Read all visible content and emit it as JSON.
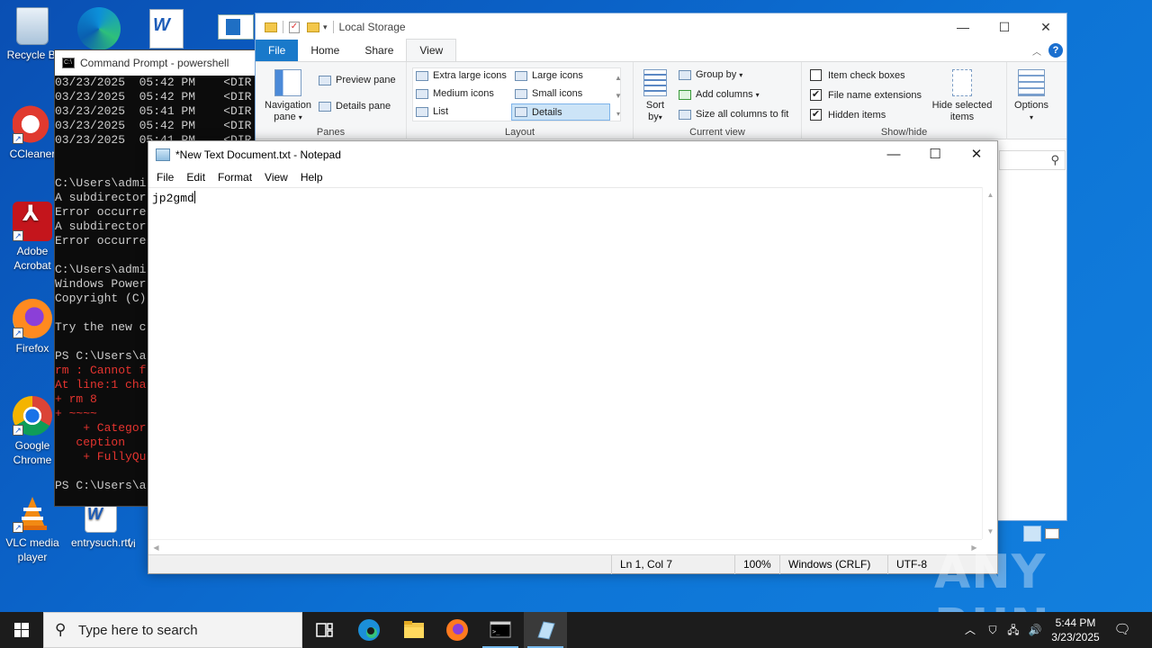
{
  "desktop": {
    "icons": [
      {
        "label": "Recycle Bin"
      },
      {
        "label": "CCleaner"
      },
      {
        "label": "Adobe Acrobat"
      },
      {
        "label": "Firefox"
      },
      {
        "label": "Google Chrome"
      },
      {
        "label": "VLC media player"
      },
      {
        "label": "entrysuch.rtf"
      }
    ],
    "recycle_label": "Recycle Bi",
    "ccleaner_label": "CCleaner",
    "acrobat_label_1": "Adobe",
    "acrobat_label_2": "Acrobat",
    "firefox_label": "Firefox",
    "chrome_label_1": "Google",
    "chrome_label_2": "Chrome",
    "vlc_label_1": "VLC media",
    "vlc_label_2": "player",
    "rtf_label": "entrysuch.rtf",
    "partial_label": "vi"
  },
  "cmd": {
    "title": "Command Prompt - powershell",
    "lines": [
      {
        "text": "03/23/2025  05:42 PM    <DIR",
        "color": "normal"
      },
      {
        "text": "03/23/2025  05:42 PM    <DIR",
        "color": "normal"
      },
      {
        "text": "03/23/2025  05:41 PM    <DIR",
        "color": "normal"
      },
      {
        "text": "03/23/2025  05:42 PM    <DIR",
        "color": "normal"
      },
      {
        "text": "03/23/2025  05:41 PM    <DIR",
        "color": "normal"
      },
      {
        "text": "",
        "color": "normal"
      },
      {
        "text": "",
        "color": "normal"
      },
      {
        "text": "C:\\Users\\admi",
        "color": "normal"
      },
      {
        "text": "A subdirector",
        "color": "normal"
      },
      {
        "text": "Error occurre",
        "color": "normal"
      },
      {
        "text": "A subdirector",
        "color": "normal"
      },
      {
        "text": "Error occurre",
        "color": "normal"
      },
      {
        "text": "",
        "color": "normal"
      },
      {
        "text": "C:\\Users\\admi",
        "color": "normal"
      },
      {
        "text": "Windows Power",
        "color": "normal"
      },
      {
        "text": "Copyright (C)",
        "color": "normal"
      },
      {
        "text": "",
        "color": "normal"
      },
      {
        "text": "Try the new c",
        "color": "normal"
      },
      {
        "text": "",
        "color": "normal"
      },
      {
        "text": "PS C:\\Users\\a",
        "color": "normal"
      },
      {
        "text": "rm : Cannot f",
        "color": "red"
      },
      {
        "text": "At line:1 cha",
        "color": "red"
      },
      {
        "text": "+ rm 8",
        "color": "red"
      },
      {
        "text": "+ ~~~~",
        "color": "red"
      },
      {
        "text": "    + Categor",
        "color": "red"
      },
      {
        "text": "   ception",
        "color": "red"
      },
      {
        "text": "    + FullyQu",
        "color": "red"
      },
      {
        "text": "",
        "color": "normal"
      },
      {
        "text": "PS C:\\Users\\a",
        "color": "normal"
      }
    ]
  },
  "explorer": {
    "title": "Local Storage",
    "tabs": [
      {
        "label": "File"
      },
      {
        "label": "Home"
      },
      {
        "label": "Share"
      },
      {
        "label": "View"
      }
    ],
    "panes": {
      "navigation_pane_1": "Navigation",
      "navigation_pane_2": "pane",
      "preview_pane": "Preview pane",
      "details_pane": "Details pane",
      "group_label": "Panes"
    },
    "layout": {
      "extra_large": "Extra large icons",
      "large": "Large icons",
      "medium": "Medium icons",
      "small": "Small icons",
      "list": "List",
      "details": "Details",
      "group_label": "Layout"
    },
    "current_view": {
      "sort_1": "Sort",
      "sort_2": "by",
      "group_by": "Group by",
      "add_columns": "Add columns",
      "size_columns": "Size all columns to fit",
      "group_label": "Current view"
    },
    "show_hide": {
      "item_check_boxes": "Item check boxes",
      "item_check_boxes_checked": false,
      "file_name_extensions": "File name extensions",
      "file_name_extensions_checked": true,
      "hidden_items": "Hidden items",
      "hidden_items_checked": true,
      "hide_selected_1": "Hide selected",
      "hide_selected_2": "items",
      "group_label": "Show/hide"
    },
    "options": "Options"
  },
  "notepad": {
    "title": "*New Text Document.txt - Notepad",
    "menu": [
      {
        "label": "File"
      },
      {
        "label": "Edit"
      },
      {
        "label": "Format"
      },
      {
        "label": "View"
      },
      {
        "label": "Help"
      }
    ],
    "content": "jp2gmd",
    "status": {
      "position": "Ln 1, Col 7",
      "zoom": "100%",
      "line_ending": "Windows (CRLF)",
      "encoding": "UTF-8"
    }
  },
  "taskbar": {
    "search_placeholder": "Type here to search",
    "time": "5:44 PM",
    "date": "3/23/2025"
  },
  "watermark": "ANY RUN"
}
